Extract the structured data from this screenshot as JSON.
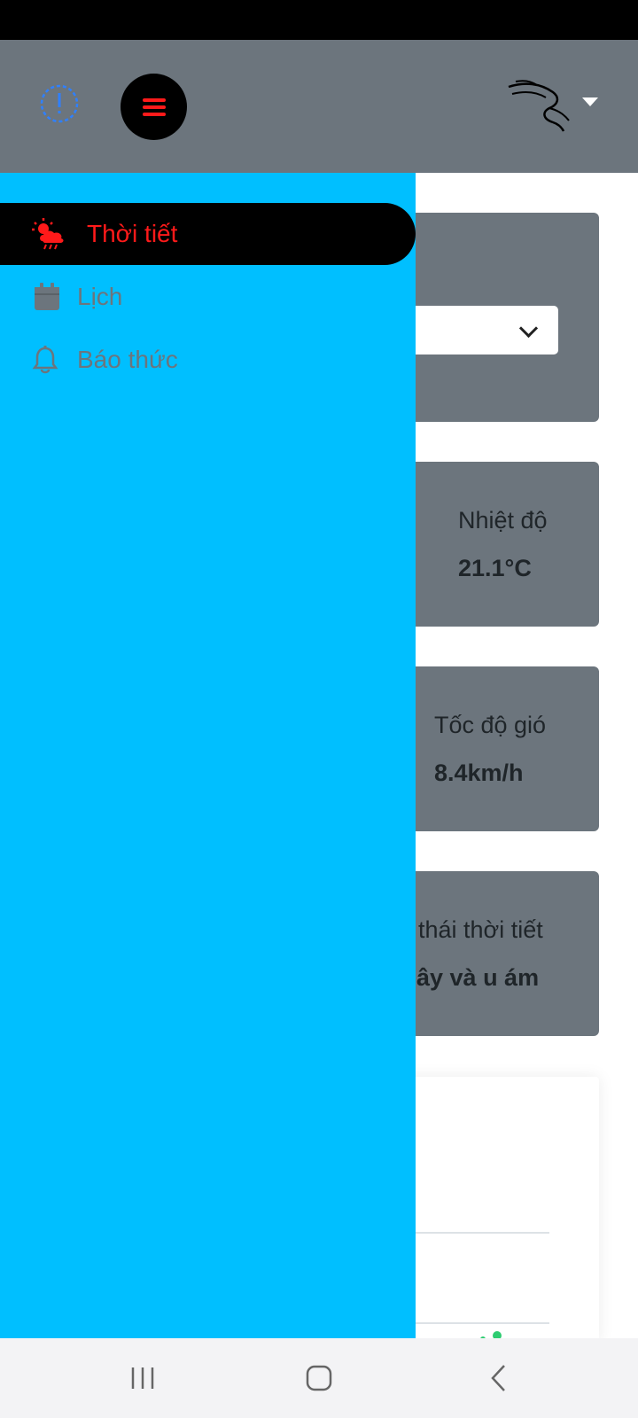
{
  "drawer": {
    "items": [
      {
        "label": "Thời tiết",
        "icon": "weather-icon",
        "active": true
      },
      {
        "label": "Lịch",
        "icon": "calendar-icon",
        "active": false
      },
      {
        "label": "Báo thức",
        "icon": "bell-icon",
        "active": false
      }
    ]
  },
  "main": {
    "cards": [
      {
        "label": "Nhiệt độ",
        "value": "21.1°C"
      },
      {
        "label": "Tốc độ gió",
        "value": "8.4km/h"
      },
      {
        "label": "thái thời tiết",
        "value": "ây và u ám"
      }
    ]
  },
  "colors": {
    "drawer_bg": "#00bfff",
    "topbar_bg": "#6c757d",
    "active_text": "#ff1a1a",
    "inactive_text": "#6c757d"
  },
  "icons": {
    "info": "info-icon",
    "menu": "hamburger-icon",
    "logo": "dragon-logo",
    "user_dropdown": "caret-down-icon",
    "system_nav": [
      "recent-apps-icon",
      "home-icon",
      "back-icon"
    ]
  }
}
